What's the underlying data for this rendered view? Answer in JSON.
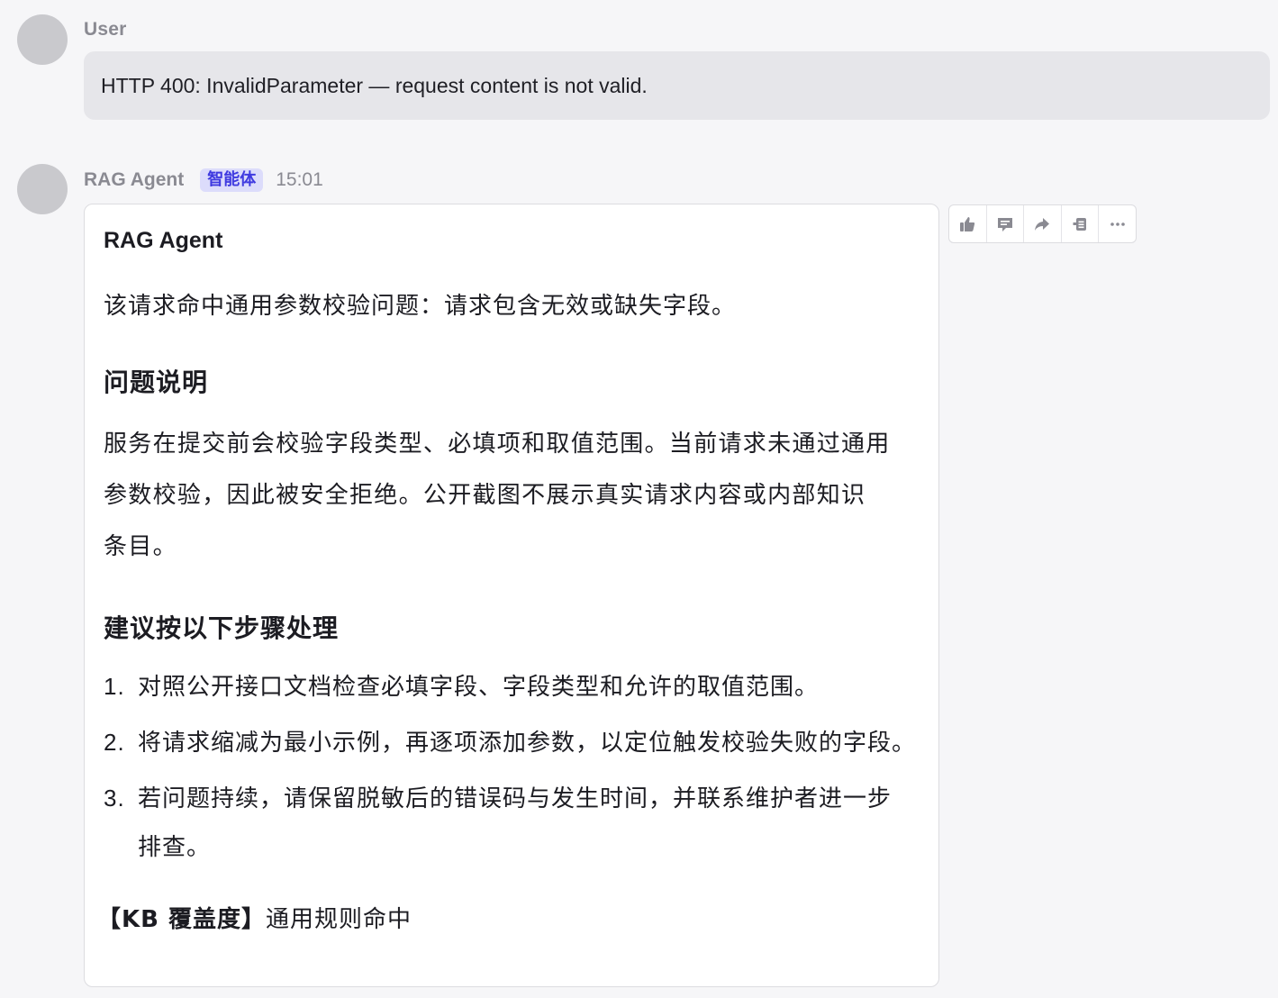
{
  "user": {
    "name": "User",
    "message": "HTTP 400: InvalidParameter — request content is not valid."
  },
  "agent": {
    "name": "RAG Agent",
    "badge": "智能体",
    "time": "15:01"
  },
  "reply": {
    "title": "RAG Agent",
    "summary": "该请求命中通用参数校验问题：请求包含无效或缺失字段。",
    "section1_heading": "问题说明",
    "section1_lines": [
      "服务在提交前会校验字段类型、必填项和取值范围。当前请求未通过通用",
      "参数校验，因此被安全拒绝。公开截图不展示真实请求内容或内部知识",
      "条目。"
    ],
    "section2_heading": "建议按以下步骤处理",
    "steps": [
      {
        "num": "1.",
        "lines": [
          "对照公开接口文档检查必填字段、字段类型和允许的取值范围。"
        ]
      },
      {
        "num": "2.",
        "lines": [
          "将请求缩减为最小示例，再逐项添加参数，以定位触发校验失败的字段。"
        ]
      },
      {
        "num": "3.",
        "lines": [
          "若问题持续，请保留脱敏后的错误码与发生时间，并联系维护者进一步",
          "排查。"
        ]
      }
    ],
    "kb_label": "【KB 覆盖度】",
    "kb_value": "通用规则命中"
  },
  "toolbar": {
    "icons": [
      "thumbs-up-icon",
      "comment-icon",
      "share-icon",
      "copy-icon",
      "more-icon"
    ]
  },
  "colors": {
    "background": "#f6f6f8",
    "user_bubble": "#e6e6ea",
    "badge_bg": "#dcdcfb",
    "badge_text": "#3f3ae0",
    "icon": "#8a8a92"
  }
}
